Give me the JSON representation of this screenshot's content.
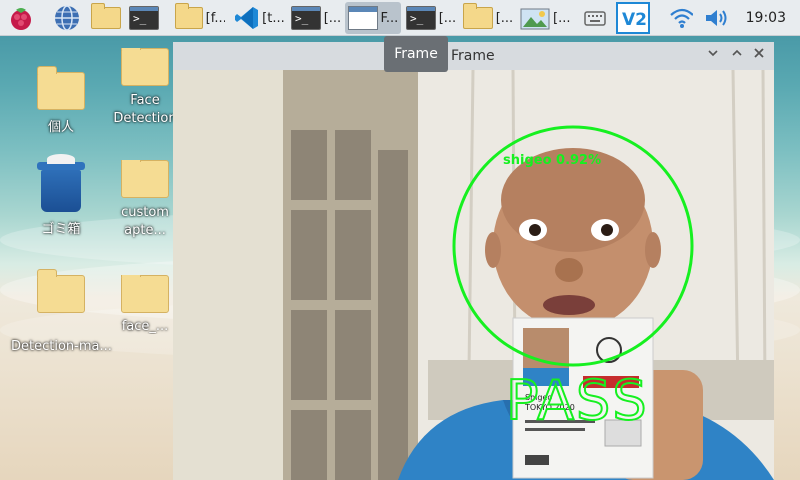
{
  "taskbar": {
    "items": [
      {
        "label": "[f..."
      },
      {
        "label": "[t..."
      },
      {
        "label": "[..."
      },
      {
        "label": "F..."
      },
      {
        "label": "[..."
      },
      {
        "label": "[..."
      },
      {
        "label": "[..."
      }
    ],
    "clock": "19:03"
  },
  "desktop": {
    "icons": [
      {
        "label": "個人"
      },
      {
        "label": "Face Detection"
      },
      {
        "label": "ゴミ箱"
      },
      {
        "label": "custom apte..."
      },
      {
        "label": "Detection-ma..."
      },
      {
        "label": "face_..."
      }
    ]
  },
  "window": {
    "title": "Frame",
    "tooltip": "Frame"
  },
  "camera": {
    "detection_label": "shigeo 0.92%",
    "result_text": "PASS",
    "badge_line1": "TOKYO 2020",
    "badge_name": "Shigeo",
    "detect_color": "#16f020"
  }
}
